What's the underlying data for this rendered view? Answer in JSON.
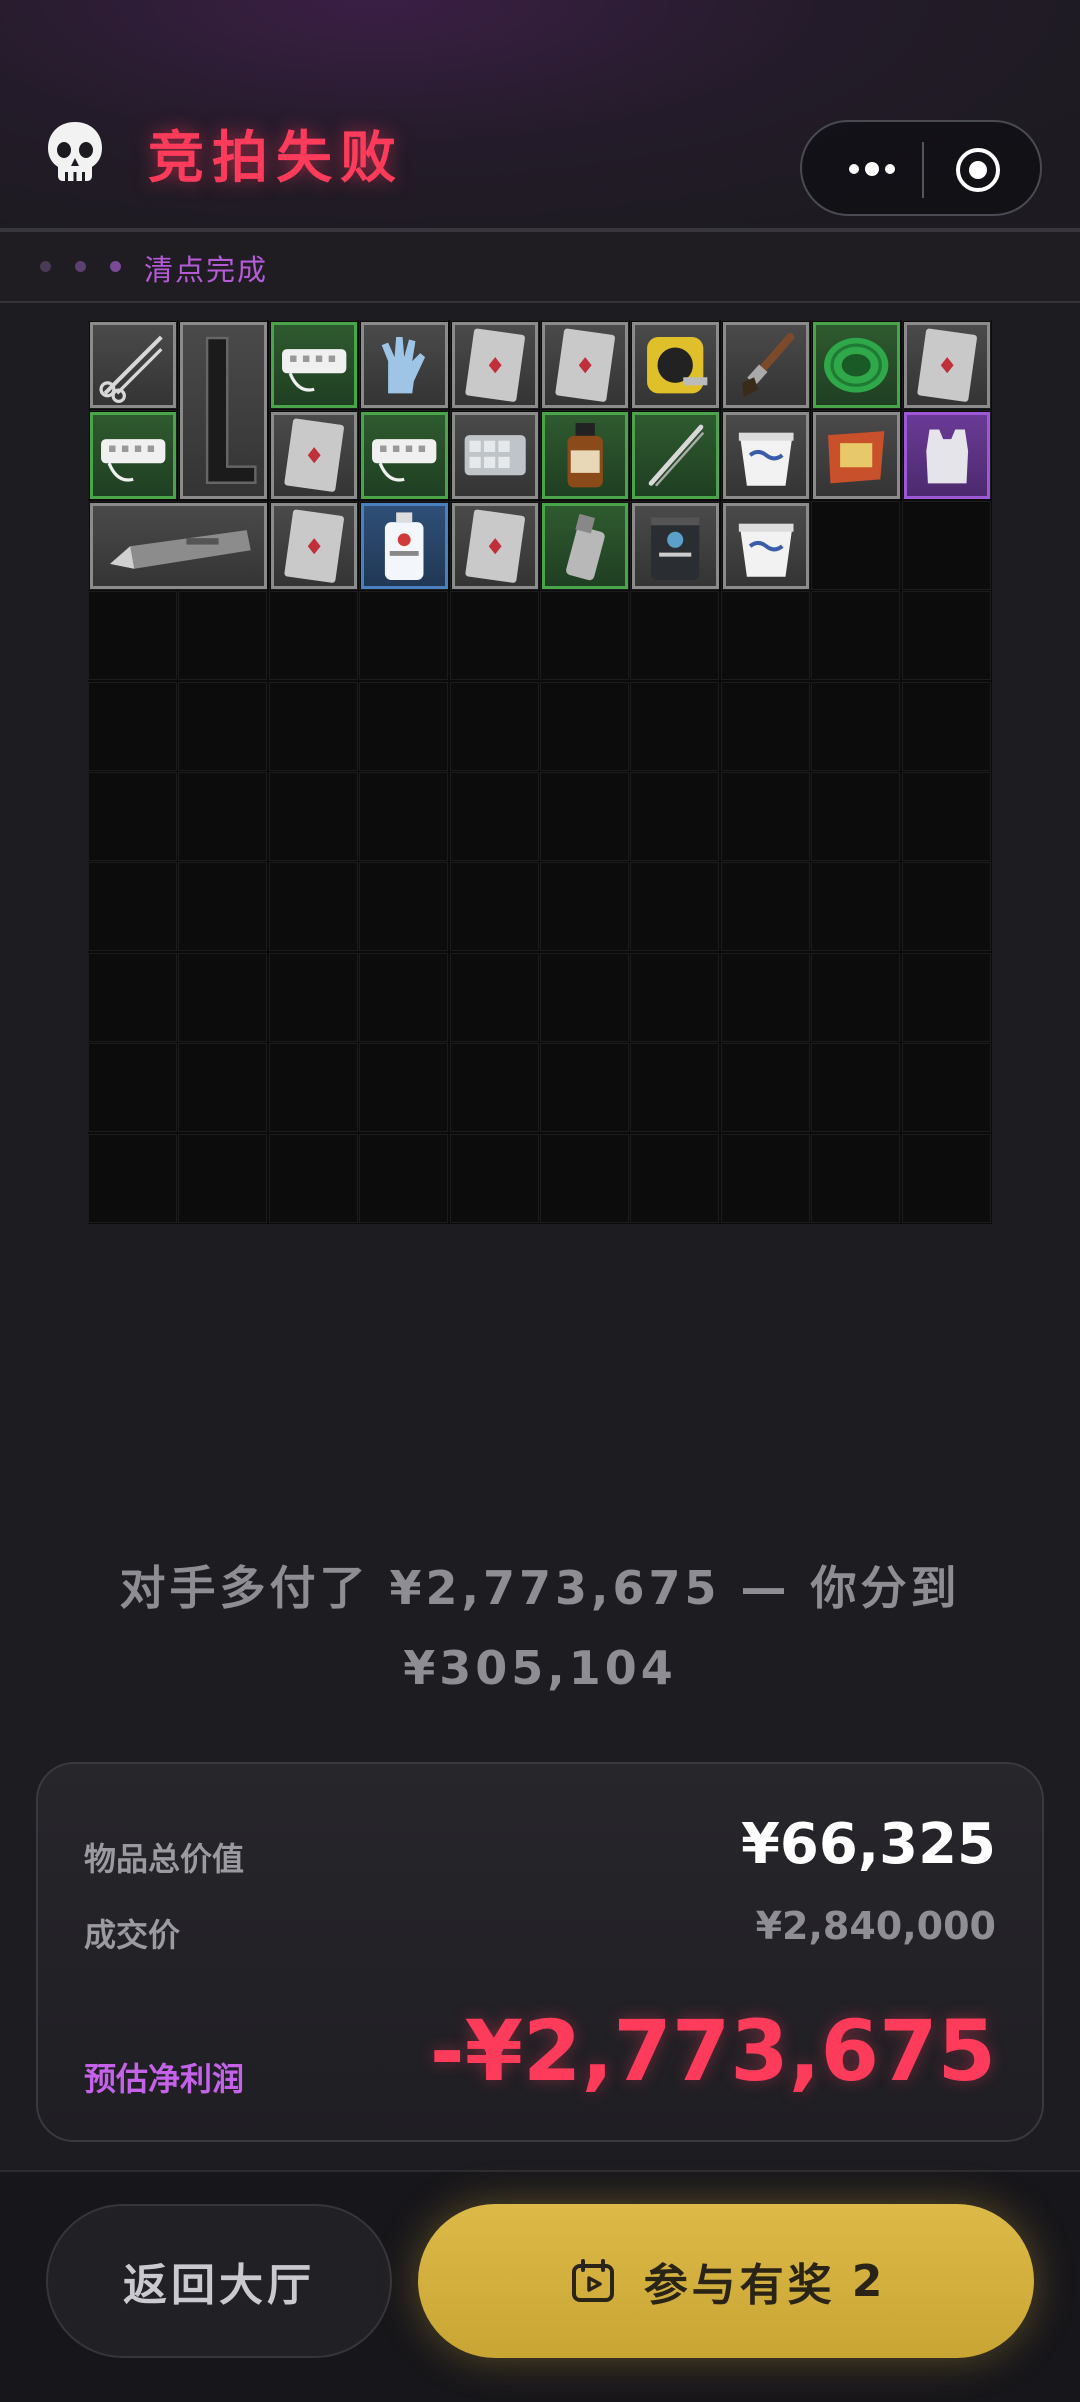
{
  "header": {
    "title": "竞拍失败",
    "icon": "skull-icon",
    "accent_color": "#ff3b5c"
  },
  "status": {
    "text": "清点完成",
    "color": "#b45bd8"
  },
  "message": {
    "line1": "对手多付了 ¥2,773,675 — 你分到",
    "line2": "¥305,104"
  },
  "summary": {
    "total_value_label": "物品总价值",
    "total_value": "¥66,325",
    "deal_price_label": "成交价",
    "deal_price": "¥2,840,000",
    "net_profit_label": "预估净利润",
    "net_profit": "-¥2,773,675",
    "net_profit_color": "#ff3b5c",
    "net_profit_label_color": "#c463ea"
  },
  "buttons": {
    "back_label": "返回大厅",
    "join_label": "参与有奖",
    "join_count": "2",
    "join_color": "#d6b240"
  },
  "grid": {
    "columns": 10,
    "rows": 10,
    "items": [
      {
        "name": "scissors-item",
        "rarity": "gray"
      },
      {
        "name": "metal-angle-item",
        "rarity": "gray"
      },
      {
        "name": "power-strip-item",
        "rarity": "green"
      },
      {
        "name": "gloves-item",
        "rarity": "gray"
      },
      {
        "name": "playing-card-item",
        "rarity": "gray"
      },
      {
        "name": "playing-card-item",
        "rarity": "gray"
      },
      {
        "name": "tape-measure-item",
        "rarity": "gray"
      },
      {
        "name": "paint-brush-item",
        "rarity": "gray"
      },
      {
        "name": "cable-spool-item",
        "rarity": "green"
      },
      {
        "name": "playing-card-item",
        "rarity": "gray"
      },
      {
        "name": "power-strip-item",
        "rarity": "green"
      },
      {
        "name": "playing-card-item",
        "rarity": "gray"
      },
      {
        "name": "power-strip-item",
        "rarity": "green"
      },
      {
        "name": "pill-tray-item",
        "rarity": "gray"
      },
      {
        "name": "medicine-bottle-item",
        "rarity": "green"
      },
      {
        "name": "tweezers-item",
        "rarity": "green"
      },
      {
        "name": "yogurt-cup-item",
        "rarity": "gray"
      },
      {
        "name": "snack-bag-item",
        "rarity": "gray"
      },
      {
        "name": "vest-item",
        "rarity": "purple"
      },
      {
        "name": "utility-knife-item",
        "rarity": "gray"
      },
      {
        "name": "playing-card-item",
        "rarity": "gray"
      },
      {
        "name": "saline-bottle-item",
        "rarity": "blue"
      },
      {
        "name": "playing-card-item",
        "rarity": "gray"
      },
      {
        "name": "lighter-item",
        "rarity": "green"
      },
      {
        "name": "protein-can-item",
        "rarity": "gray"
      },
      {
        "name": "yogurt-cup-item",
        "rarity": "gray"
      }
    ]
  }
}
